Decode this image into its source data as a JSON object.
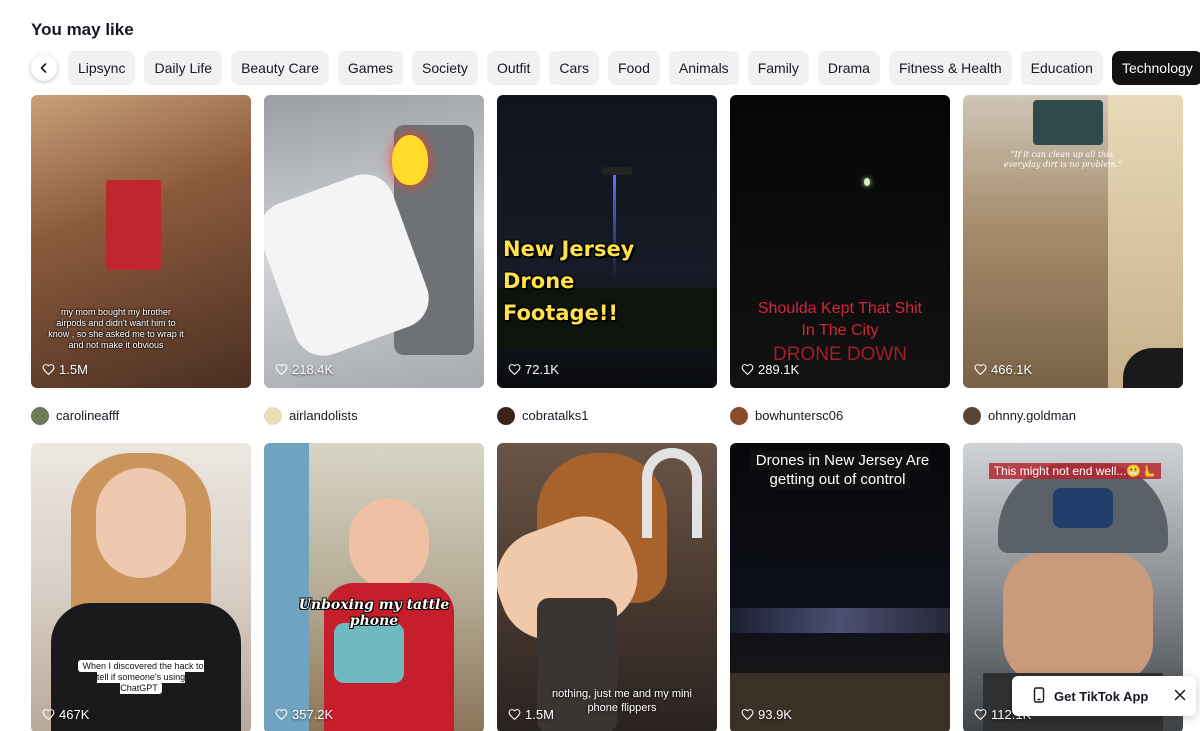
{
  "section": {
    "title": "You may like"
  },
  "categories": [
    "Lipsync",
    "Daily Life",
    "Beauty Care",
    "Games",
    "Society",
    "Outfit",
    "Cars",
    "Food",
    "Animals",
    "Family",
    "Drama",
    "Fitness & Health",
    "Education",
    "Technology"
  ],
  "selected_category": "Technology",
  "icons": {
    "prev": "chevron-left-icon",
    "like": "heart-outline-icon",
    "app": "phone-icon",
    "close": "close-icon"
  },
  "videos": [
    {
      "likes": "1.5M",
      "author": "carolineafff",
      "caption": "my mom bought my brother airpods and didn't want him to know , so she asked me to wrap it and not make it obvious"
    },
    {
      "likes": "218.4K",
      "author": "airlandolists",
      "caption": ""
    },
    {
      "likes": "72.1K",
      "author": "cobratalks1",
      "caption": "New Jersey Drone Footage!!"
    },
    {
      "likes": "289.1K",
      "author": "bowhuntersc06",
      "caption": "Shoulda Kept That Shit In The City",
      "caption2": "DRONE DOWN"
    },
    {
      "likes": "466.1K",
      "author": "ohnny.goldman",
      "caption": "“If it can clean up all this, everyday dirt is no problem.”"
    },
    {
      "likes": "467K",
      "author": "",
      "caption": "When I discovered the hack to tell if someone's using ChatGPT"
    },
    {
      "likes": "357.2K",
      "author": "",
      "caption": "Unboxing my tattle phone"
    },
    {
      "likes": "1.5M",
      "author": "",
      "caption": "nothing, just me and my mini phone flippers"
    },
    {
      "likes": "93.9K",
      "author": "",
      "caption": "Drones in New Jersey Are getting out of control"
    },
    {
      "likes": "112.1K",
      "author": "",
      "caption": "This might not end well...😬🫷"
    }
  ],
  "get_app": {
    "label": "Get TikTok App"
  }
}
